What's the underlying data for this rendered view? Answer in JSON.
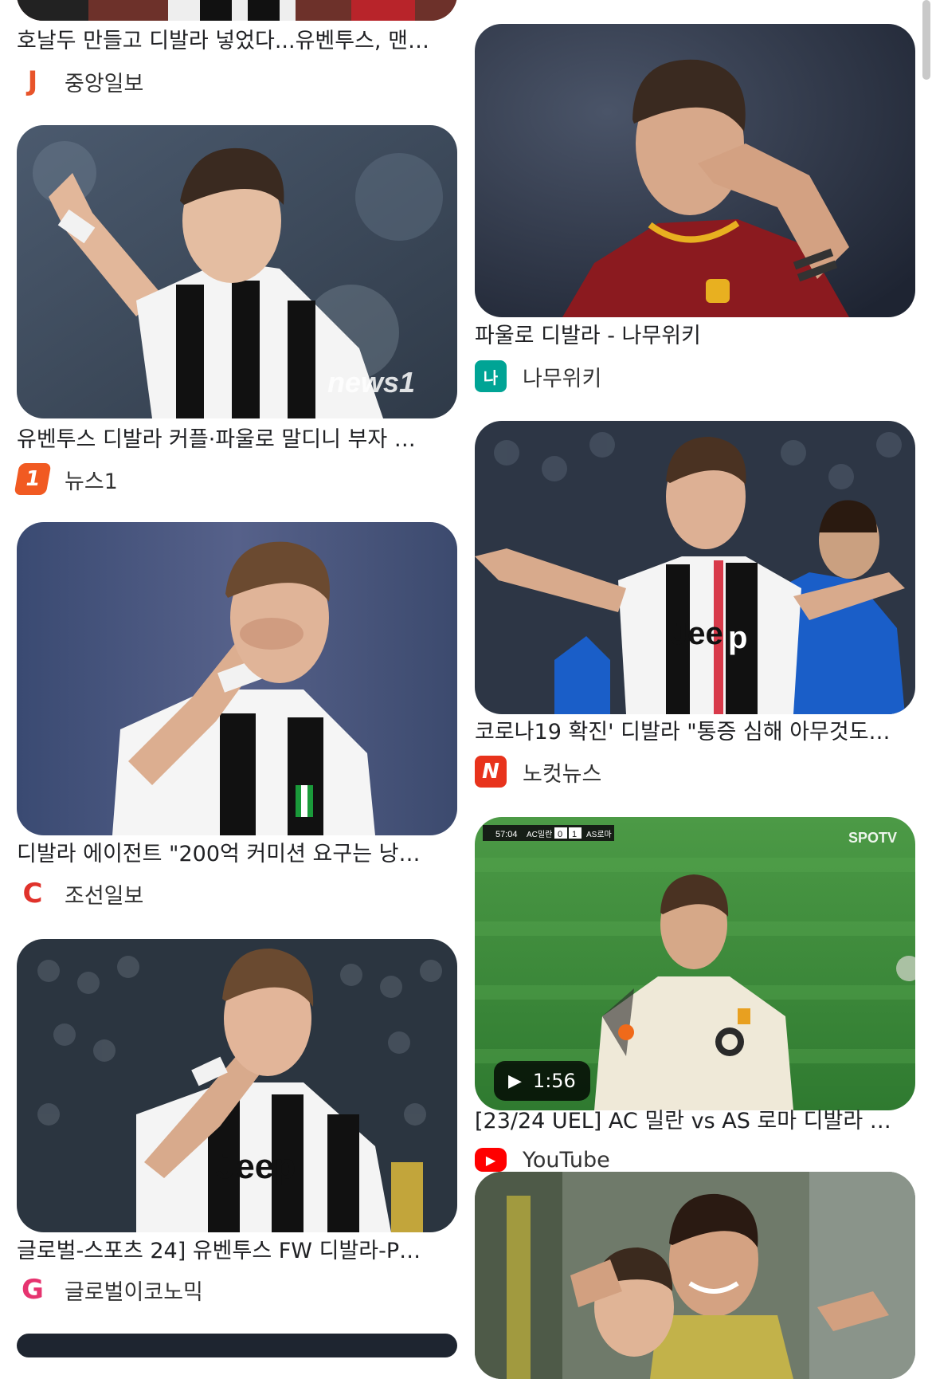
{
  "left_column": [
    {
      "title": "호날두 만들고 디발라 넣었다...유벤투스, 맨…",
      "source": "중앙일보",
      "logo_text": "J",
      "logo_color": "#e8542a"
    },
    {
      "title": "유벤투스 디발라 커플·파울로 말디니 부자 …",
      "source": "뉴스1",
      "logo_text": "1",
      "logo_color": "#f15a22",
      "watermark": "news1"
    },
    {
      "title": "디발라 에이전트 \"200억 커미션 요구는 낭…",
      "source": "조선일보",
      "logo_text": "C",
      "logo_color": "#e0322b"
    },
    {
      "title": "글로벌-스포츠 24] 유벤투스 FW 디발라-P…",
      "source": "글로벌이코노믹",
      "logo_text": "G",
      "logo_color": "#e6336f"
    }
  ],
  "right_column": [
    {
      "title": "파울로 디발라 - 나무위키",
      "source": "나무위키",
      "logo_text": "나",
      "logo_color": "#00a495"
    },
    {
      "title": "코로나19 확진' 디발라 \"통증 심해 아무것도…",
      "source": "노컷뉴스",
      "logo_text": "N",
      "logo_color": "#e8331c"
    },
    {
      "title": "[23/24 UEL] AC 밀란 vs AS 로마 디발라 …",
      "source": "YouTube",
      "logo_text": "▶",
      "logo_color": "#ff0000",
      "video_duration": "1:56",
      "broadcaster": "SPOTV",
      "scoreboard": {
        "time": "57:04",
        "home": "AC밀란",
        "home_score": "0",
        "away_score": "1",
        "away": "AS로마"
      }
    }
  ],
  "colors": {
    "juventus_black": "#111111",
    "juventus_white": "#f5f5f5",
    "roma_red": "#8b1a1f",
    "pitch_green": "#3f8a3a",
    "stadium_blue": "#3a4660"
  }
}
